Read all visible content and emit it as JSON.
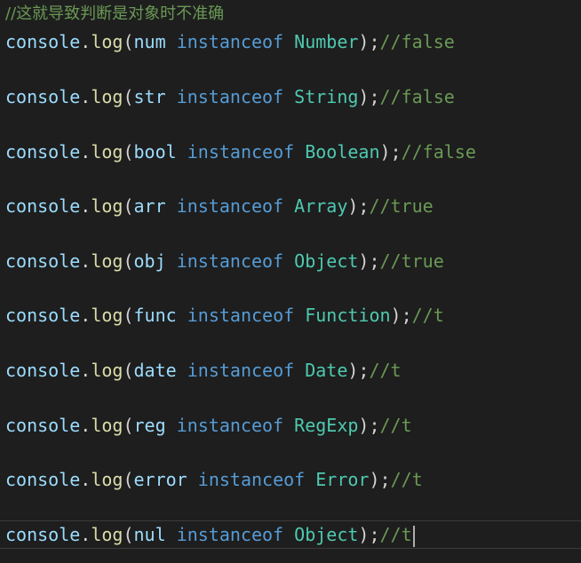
{
  "header_comment": "//这就导致判断是对象时不准确",
  "lines": [
    {
      "obj": "console",
      "dot": ".",
      "fn": "log",
      "open": "(",
      "var": "num",
      "kw": "instanceof",
      "type": "Number",
      "close": ");",
      "comment": "//false"
    },
    {
      "obj": "console",
      "dot": ".",
      "fn": "log",
      "open": "(",
      "var": "str",
      "kw": "instanceof",
      "type": "String",
      "close": ");",
      "comment": "//false"
    },
    {
      "obj": "console",
      "dot": ".",
      "fn": "log",
      "open": "(",
      "var": "bool",
      "kw": "instanceof",
      "type": "Boolean",
      "close": ");",
      "comment": "//false"
    },
    {
      "obj": "console",
      "dot": ".",
      "fn": "log",
      "open": "(",
      "var": "arr",
      "kw": "instanceof",
      "type": "Array",
      "close": ");",
      "comment": "//true"
    },
    {
      "obj": "console",
      "dot": ".",
      "fn": "log",
      "open": "(",
      "var": "obj",
      "kw": "instanceof",
      "type": "Object",
      "close": ");",
      "comment": "//true"
    },
    {
      "obj": "console",
      "dot": ".",
      "fn": "log",
      "open": "(",
      "var": "func",
      "kw": "instanceof",
      "type": "Function",
      "close": ");",
      "comment": "//t"
    },
    {
      "obj": "console",
      "dot": ".",
      "fn": "log",
      "open": "(",
      "var": "date",
      "kw": "instanceof",
      "type": "Date",
      "close": ");",
      "comment": "//t"
    },
    {
      "obj": "console",
      "dot": ".",
      "fn": "log",
      "open": "(",
      "var": "reg",
      "kw": "instanceof",
      "type": "RegExp",
      "close": ");",
      "comment": "//t"
    },
    {
      "obj": "console",
      "dot": ".",
      "fn": "log",
      "open": "(",
      "var": "error",
      "kw": "instanceof",
      "type": "Error",
      "close": ");",
      "comment": "//t"
    },
    {
      "obj": "console",
      "dot": ".",
      "fn": "log",
      "open": "(",
      "var": "nul",
      "kw": "instanceof",
      "type": "Object",
      "close": ");",
      "comment": "//t"
    }
  ],
  "colors": {
    "background": "#1e1e1e",
    "keyword": "#569cd6",
    "variable": "#9cdcfe",
    "function": "#dcdcaa",
    "type": "#4ec9b0",
    "comment": "#6a9955",
    "punctuation": "#d4d4d4"
  }
}
